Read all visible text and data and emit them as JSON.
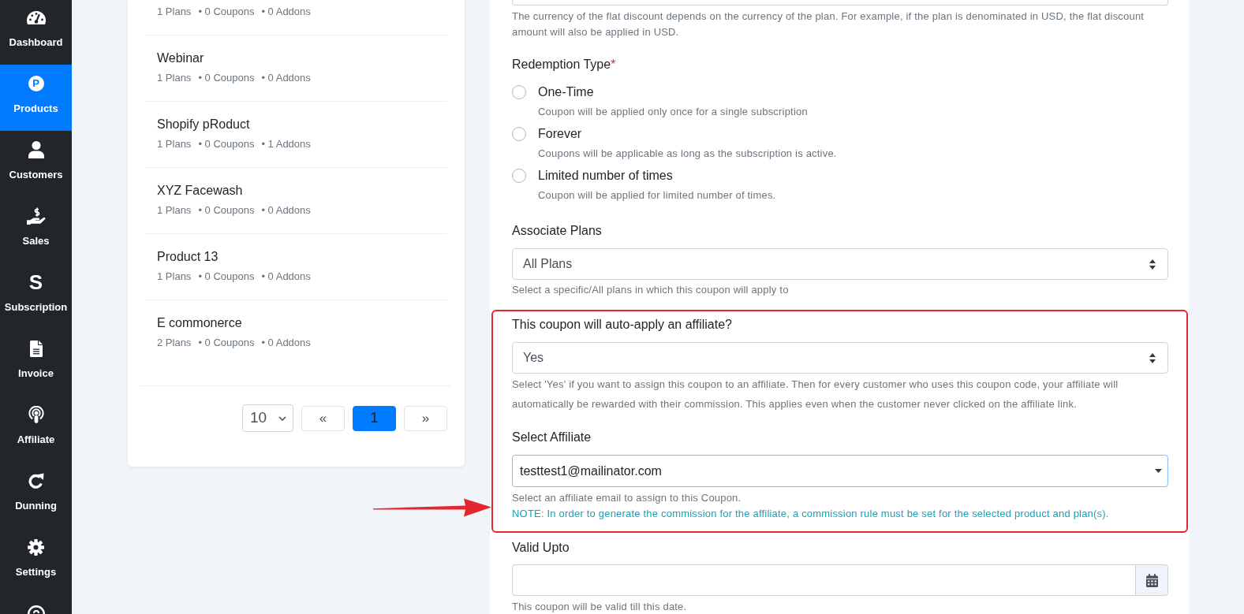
{
  "sidebar": {
    "items": [
      {
        "label": "Dashboard",
        "selected": false
      },
      {
        "label": "Products",
        "selected": true,
        "glyph": "P"
      },
      {
        "label": "Customers",
        "selected": false
      },
      {
        "label": "Sales",
        "selected": false
      },
      {
        "label": "Subscription",
        "selected": false,
        "glyph": "S"
      },
      {
        "label": "Invoice",
        "selected": false
      },
      {
        "label": "Affiliate",
        "selected": false
      },
      {
        "label": "Dunning",
        "selected": false
      },
      {
        "label": "Settings",
        "selected": false
      }
    ]
  },
  "products": {
    "items": [
      {
        "stats": [
          "1 Plans",
          "• 0 Coupons",
          "• 0 Addons"
        ]
      },
      {
        "name": "Webinar",
        "stats": [
          "1 Plans",
          "• 0 Coupons",
          "• 0 Addons"
        ]
      },
      {
        "name": "Shopify pRoduct",
        "stats": [
          "1 Plans",
          "• 0 Coupons",
          "• 1 Addons"
        ]
      },
      {
        "name": "XYZ Facewash",
        "stats": [
          "1 Plans",
          "• 0 Coupons",
          "• 0 Addons"
        ]
      },
      {
        "name": "Product 13",
        "stats": [
          "1 Plans",
          "• 0 Coupons",
          "• 0 Addons"
        ]
      },
      {
        "name": "E commonerce",
        "stats": [
          "2 Plans",
          "• 0 Coupons",
          "• 0 Addons"
        ]
      }
    ],
    "pagination": {
      "page_size": "10",
      "pages": [
        {
          "label": "«",
          "selected": false
        },
        {
          "label": "1",
          "selected": true
        },
        {
          "label": "»",
          "selected": false
        }
      ]
    }
  },
  "coupon_form": {
    "flat_discount": {
      "help": "The currency of the flat discount depends on the currency of the plan. For example, if the plan is denominated in USD, the flat discount amount will also be applied in USD."
    },
    "redemption_type": {
      "label": "Redemption Type",
      "required_mark": "*",
      "options": [
        {
          "label": "One-Time",
          "description": "Coupon will be applied only once for a single subscription",
          "selected": false
        },
        {
          "label": "Forever",
          "description": "Coupons will be applicable as long as the subscription is active.",
          "selected": false
        },
        {
          "label": "Limited number of times",
          "description": "Coupon will be applied for limited number of times.",
          "selected": false
        }
      ]
    },
    "associate_plans": {
      "label": "Associate Plans",
      "value": "All Plans",
      "help": "Select a specific/All plans in which this coupon will apply to"
    },
    "affiliate_section": {
      "highlighted": true,
      "auto_apply": {
        "label": "This coupon will auto-apply an affiliate?",
        "value": "Yes",
        "help": "Select 'Yes' if you want to assign this coupon to an affiliate. Then for every customer who uses this coupon code, your affiliate will automatically be rewarded with their commission. This applies even when the customer never clicked on the affiliate link."
      },
      "select_affiliate": {
        "label": "Select Affiliate",
        "value": "testtest1@mailinator.com",
        "focused": true,
        "help": "Select an affiliate email to assign to this Coupon.",
        "note": "NOTE: In order to generate the commission for the affiliate, a commission rule must be set for the selected product and plan(s)."
      }
    },
    "valid_upto": {
      "label": "Valid Upto",
      "help": "This coupon will be valid till this date."
    }
  }
}
